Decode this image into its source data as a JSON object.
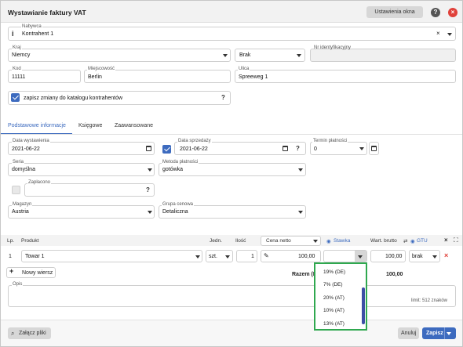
{
  "window": {
    "title": "Wystawianie faktury VAT",
    "settings_label": "Ustawienia okna",
    "help_icon": "question-circle-icon",
    "close_icon": "close-circle-icon"
  },
  "buyer": {
    "label": "Nabywca",
    "value": "Kontrahent 1",
    "country_label": "Kraj",
    "country_value": "Niemcy",
    "vat_status_value": "Brak",
    "taxid_label": "Nr identyfikacyjny",
    "taxid_value": "",
    "postcode_label": "Kod",
    "postcode_value": "11111",
    "city_label": "Miejscowość",
    "city_value": "Berlin",
    "street_label": "Ulica",
    "street_value": "Spreeweg 1",
    "save_changes_label": "zapisz zmiany do katalogu kontrahentów"
  },
  "tabs": [
    {
      "label": "Podstawowe informacje",
      "active": true
    },
    {
      "label": "Księgowe",
      "active": false
    },
    {
      "label": "Zaawansowane",
      "active": false
    }
  ],
  "basic": {
    "issue_date_label": "Data wystawienia",
    "issue_date_value": "2021-06-22",
    "sale_date_label": "Data sprzedaży",
    "sale_date_value": "2021-06-22",
    "payment_term_label": "Termin płatności",
    "payment_term_value": "0",
    "series_label": "Seria",
    "series_value": "domyślna",
    "payment_method_label": "Metoda płatności",
    "payment_method_value": "gotówka",
    "paid_label": "Zapłacono",
    "warehouse_label": "Magazyn",
    "warehouse_value": "Austria",
    "price_group_label": "Grupa cenowa",
    "price_group_value": "Detaliczna"
  },
  "table": {
    "headers": {
      "lp": "Lp.",
      "product": "Produkt",
      "unit": "Jedn.",
      "qty": "Ilość",
      "price_type": "Cena netto",
      "rate": "Stawka",
      "gross": "Wart. brutto",
      "gtu": "GTU"
    },
    "rows": [
      {
        "lp": "1",
        "product": "Towar 1",
        "unit": "szt.",
        "qty": "1",
        "price": "100,00",
        "gross": "100,00",
        "tag": "brak"
      }
    ],
    "add_row_label": "Nowy wiersz",
    "total_label": "Razem (E",
    "total_value": "100,00"
  },
  "rate_dropdown": {
    "options": [
      "19% (DE)",
      "7% (DE)",
      "20% (AT)",
      "10% (AT)",
      "13% (AT)"
    ]
  },
  "notes": {
    "label": "Opis",
    "limit_text": "limit: 512 znaków"
  },
  "footer": {
    "attach_label": "Załącz pliki",
    "cancel_label": "Anuluj",
    "save_label": "Zapisz"
  },
  "colors": {
    "accent": "#3d6bbf",
    "dropdown_border": "#2fa84f",
    "close_red": "#e0413a"
  }
}
